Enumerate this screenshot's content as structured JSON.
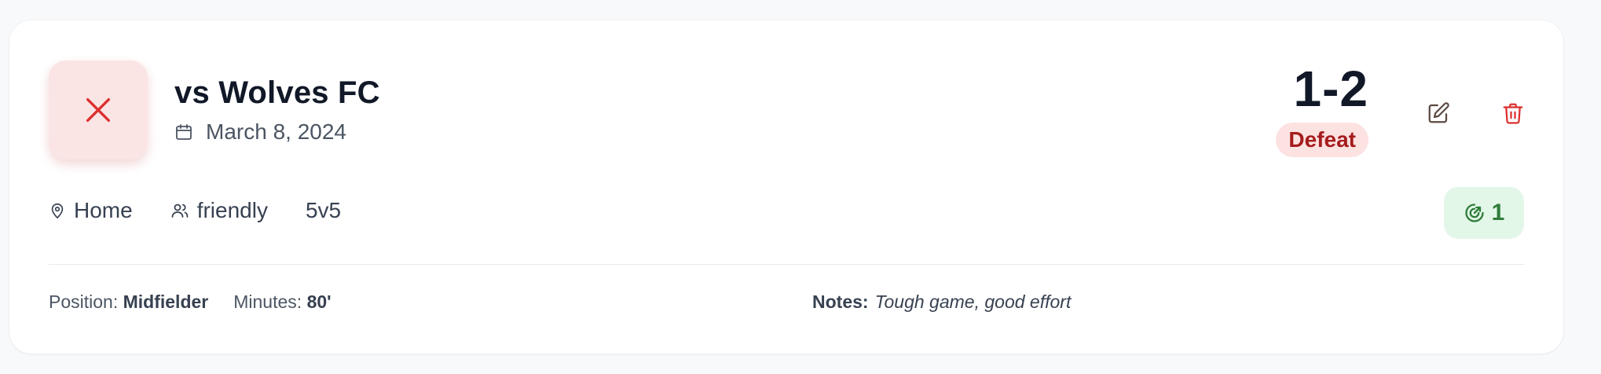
{
  "match": {
    "result_icon": "x-icon",
    "title": "vs Wolves FC",
    "date": "March 8, 2024",
    "score": "1-2",
    "outcome": "Defeat",
    "location": "Home",
    "match_type": "friendly",
    "format": "5v5",
    "goals": "1",
    "position_label": "Position:",
    "position": "Midfielder",
    "minutes_label": "Minutes:",
    "minutes": "80'",
    "notes_label": "Notes:",
    "notes": "Tough game, good effort"
  },
  "actions": {
    "edit_icon": "edit-icon",
    "delete_icon": "trash-icon"
  },
  "colors": {
    "defeat_bg": "#fbe4e4",
    "defeat_text": "#a51d1d",
    "goals_bg": "#e3f7e9",
    "goals_text": "#2f7d3a"
  }
}
